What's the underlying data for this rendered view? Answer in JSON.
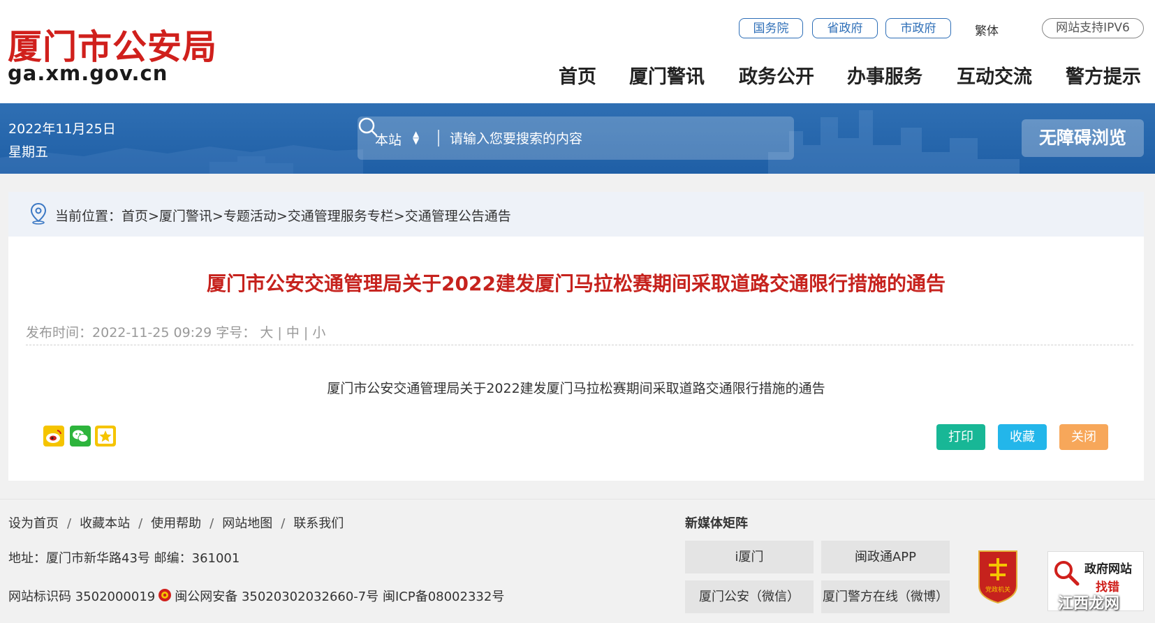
{
  "header": {
    "logo_title": "厦门市公安局",
    "logo_domain": "ga.xm.gov.cn",
    "top_links": [
      "国务院",
      "省政府",
      "市政府"
    ],
    "traditional": "繁体",
    "ipv6": "网站支持IPV6",
    "nav": [
      "首页",
      "厦门警讯",
      "政务公开",
      "办事服务",
      "互动交流",
      "警方提示"
    ]
  },
  "banner": {
    "date": "2022年11月25日",
    "weekday": "星期五",
    "search_scope": "本站",
    "search_placeholder": "请输入您要搜索的内容",
    "accessibility": "无障碍浏览"
  },
  "breadcrumb": {
    "label": "当前位置：",
    "path": "首页>厦门警讯>专题活动>交通管理服务专栏>交通管理公告通告"
  },
  "article": {
    "title": "厦门市公安交通管理局关于2022建发厦门马拉松赛期间采取道路交通限行措施的通告",
    "publish_label": "发布时间：",
    "publish_time": "2022-11-25 09:29",
    "font_label": "字号：",
    "font_large": "大",
    "font_medium": "中",
    "font_small": "小",
    "body": "厦门市公安交通管理局关于2022建发厦门马拉松赛期间采取道路交通限行措施的通告",
    "share_icons": [
      "weibo-icon",
      "wechat-icon",
      "favorite-star-icon"
    ],
    "actions": {
      "print": "打印",
      "favorite": "收藏",
      "close": "关闭"
    }
  },
  "footer": {
    "links": [
      "设为首页",
      "收藏本站",
      "使用帮助",
      "网站地图",
      "联系我们"
    ],
    "link_sep": "/",
    "address": "地址：厦门市新华路43号  邮编：361001",
    "site_id": "网站标识码 3502000019",
    "police_record": "闽公网安备 35020302032660-7号 闽ICP备08002332号",
    "new_media_title": "新媒体矩阵",
    "media_buttons": [
      "i厦门",
      "闽政通APP",
      "厦门公安（微信）",
      "厦门警方在线（微博）"
    ],
    "party_badge": "党政机关",
    "gov_error_line1": "政府网站",
    "gov_error_line2": "找错",
    "watermark": "江西龙网"
  },
  "colors": {
    "brand_red": "#d0201c",
    "title_red": "#c6221d",
    "link_blue": "#2d6eb7",
    "banner_blue": "#2f6fb3",
    "print_green": "#18b796",
    "fav_cyan": "#23b6ea",
    "close_orange": "#f7a75a"
  }
}
